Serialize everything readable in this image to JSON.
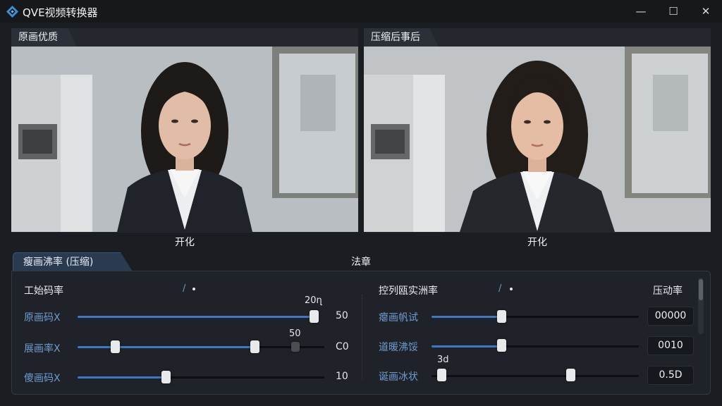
{
  "window": {
    "title": "QVE视频转换器",
    "controls": {
      "minimize": "—",
      "maximize": "☐",
      "close": "✕"
    }
  },
  "panes": [
    {
      "tab": "原画优质",
      "caption": "开化"
    },
    {
      "tab": "压缩后事后",
      "caption": "开化"
    }
  ],
  "settings": {
    "tab_label": "瘦画沸率 (压缩)",
    "center_label": "法章",
    "left": {
      "header": "工始码率",
      "header_mark": "/",
      "rows": [
        {
          "label": "原画码X",
          "value": "50",
          "tip": "20ղ"
        },
        {
          "label": "展画率X",
          "value": "C0",
          "tip": "50"
        },
        {
          "label": "傻画码X",
          "value": "10"
        }
      ]
    },
    "right": {
      "header": "控列瓯实洲率",
      "header_mark": "/",
      "header_right": "压动率",
      "rows": [
        {
          "label": "瘪画帆试",
          "value": "00000"
        },
        {
          "label": "道暖沸馁",
          "value": "0010"
        },
        {
          "label": "诞画冰状",
          "value": "0.5D",
          "tip": "3d"
        }
      ]
    }
  },
  "colors": {
    "accent": "#3f78c0",
    "label_blue": "#6e9bd1",
    "background": "#1a1d22"
  },
  "icons": {
    "app": "diamond-logo-icon"
  }
}
